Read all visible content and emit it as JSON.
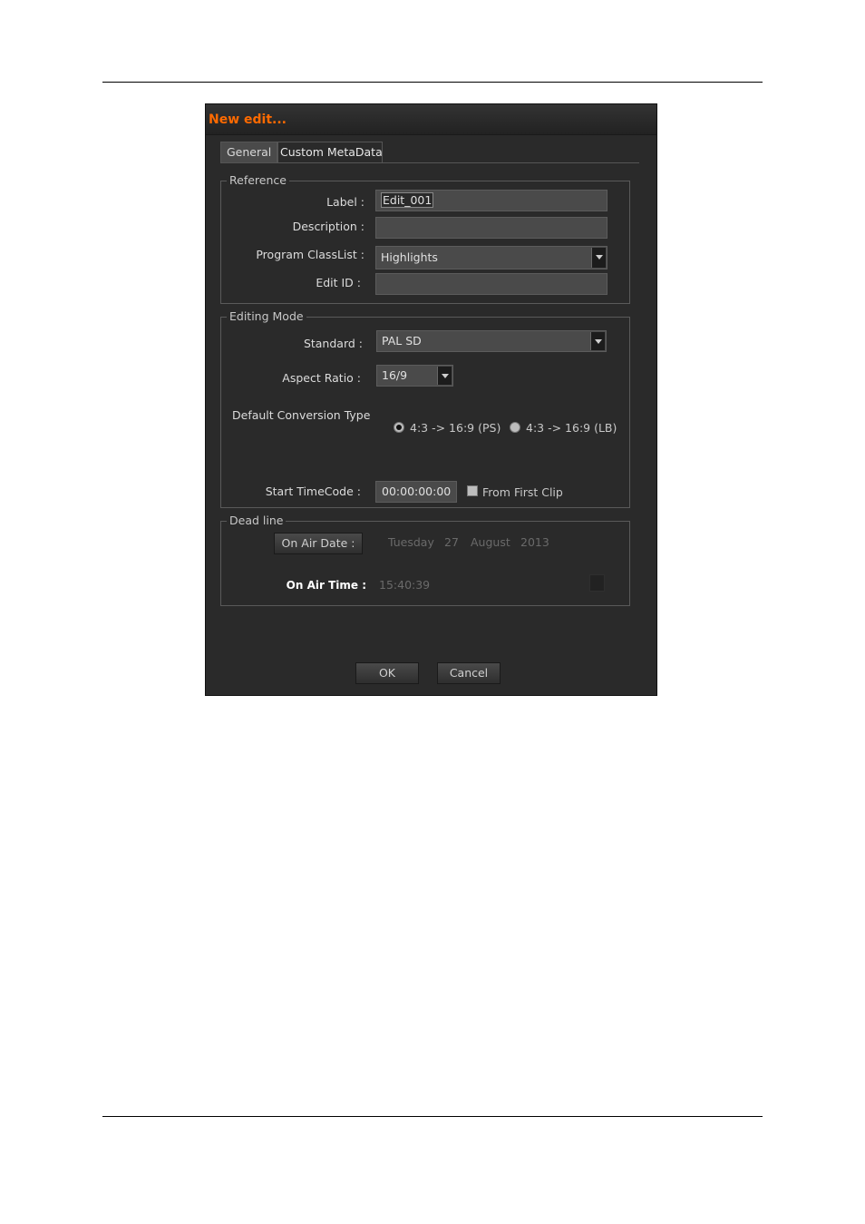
{
  "dialog": {
    "title": "New edit...",
    "accent_color": "#ff6a00"
  },
  "tabs": [
    {
      "label": "General",
      "active": true
    },
    {
      "label": "Custom MetaData",
      "active": false
    }
  ],
  "reference": {
    "legend": "Reference",
    "label_label": "Label :",
    "label_value": "Edit_001",
    "description_label": "Description :",
    "description_value": "",
    "classlist_label": "Program ClassList :",
    "classlist_value": "Highlights",
    "editid_label": "Edit ID :",
    "editid_value": ""
  },
  "editing_mode": {
    "legend": "Editing Mode",
    "standard_label": "Standard :",
    "standard_value": "PAL SD",
    "aspect_label": "Aspect Ratio :",
    "aspect_value": "16/9",
    "conversion_label": "Default Conversion Type",
    "conversion_options": [
      {
        "label": "4:3 -> 16:9 (PS)",
        "selected": true
      },
      {
        "label": "4:3 -> 16:9 (LB)",
        "selected": false
      }
    ],
    "timecode_label": "Start TimeCode :",
    "timecode_value": "00:00:00:00",
    "from_first_clip_label": "From First Clip",
    "from_first_clip_checked": false
  },
  "deadline": {
    "legend": "Dead line",
    "on_air_date_button": "On Air Date :",
    "date_weekday": "Tuesday",
    "date_day": "27",
    "date_month": "August",
    "date_year": "2013",
    "on_air_time_label": "On Air Time :",
    "on_air_time_value": "15:40:39"
  },
  "buttons": {
    "ok": "OK",
    "cancel": "Cancel"
  }
}
